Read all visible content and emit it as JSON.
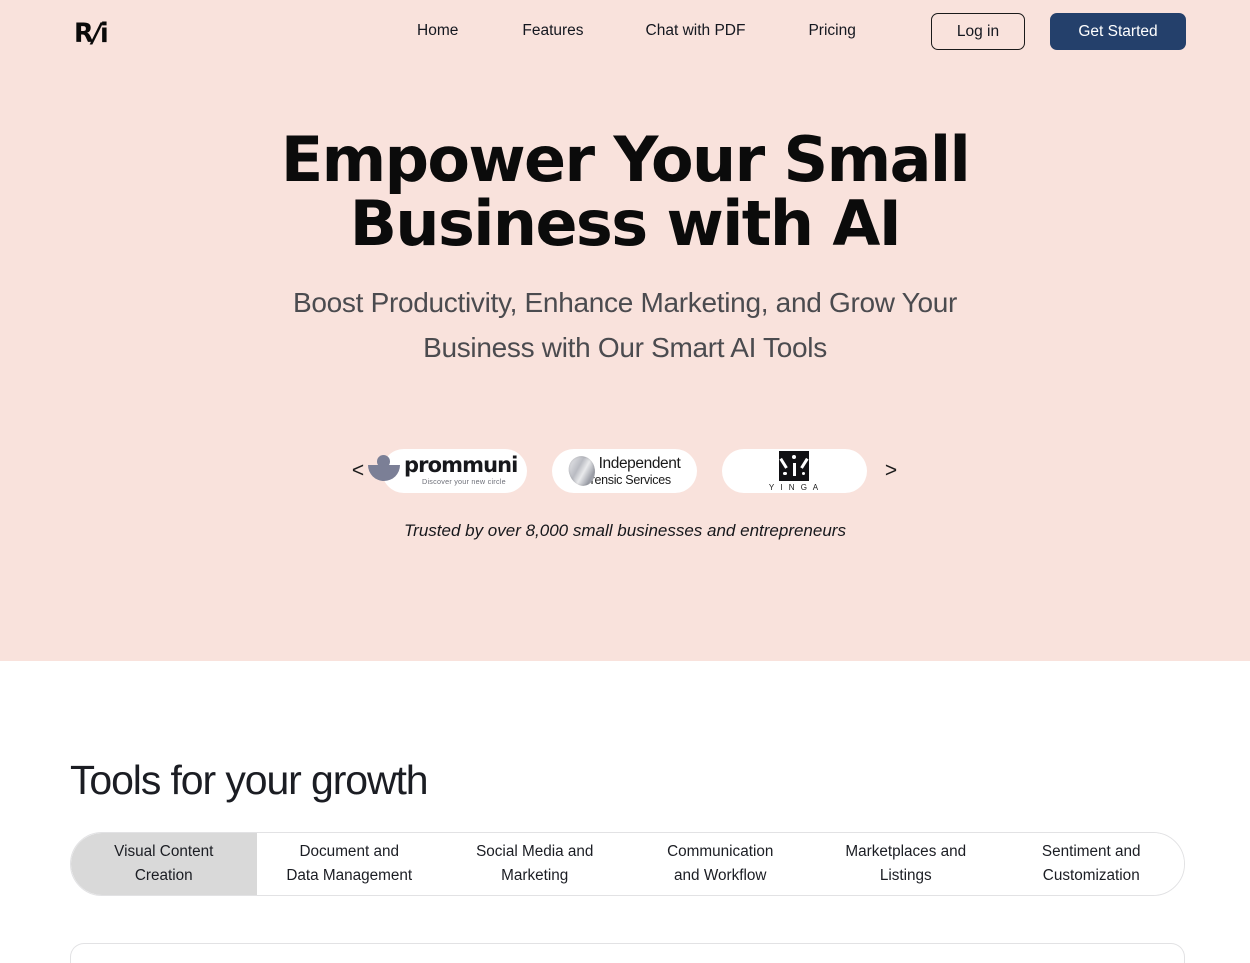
{
  "brand": {
    "logo_text": "R/i",
    "logo_part1": "R",
    "logo_slash": "/",
    "logo_part2": "i"
  },
  "colors": {
    "hero_bg": "#F9E2DC",
    "accent_navy": "#24406B",
    "active_tab_gray": "#D9D9D9",
    "text_dark": "#0B0B0B",
    "text_muted": "#4B4B4F"
  },
  "nav": {
    "links": [
      {
        "label": "Home"
      },
      {
        "label": "Features"
      },
      {
        "label": "Chat with PDF"
      },
      {
        "label": "Pricing"
      }
    ],
    "login_label": "Log in",
    "get_started_label": "Get Started"
  },
  "hero": {
    "headline_line1": "Empower Your Small",
    "headline_line2": "Business with AI",
    "subhead_line1": "Boost Productivity, Enhance Marketing, and Grow Your",
    "subhead_line2": "Business with Our Smart AI Tools",
    "trusted_text": "Trusted by over 8,000 small businesses and entrepreneurs"
  },
  "carousel": {
    "prev_label": "<",
    "next_label": ">",
    "logos": [
      {
        "name": "prommuni",
        "tagline": "Discover your new circle",
        "icon": "prommuni-logo-icon"
      },
      {
        "name_line1": "Independent",
        "name_line2": "Forensic Services",
        "icon": "independent-forensic-services-logo-icon"
      },
      {
        "name": "Y I N G A",
        "icon": "yinga-logo-icon"
      }
    ]
  },
  "tools": {
    "title": "Tools for your growth",
    "tabs": [
      {
        "line1": "Visual Content",
        "line2": "Creation",
        "active": true
      },
      {
        "line1": "Document and",
        "line2": "Data Management",
        "active": false
      },
      {
        "line1": "Social Media and",
        "line2": "Marketing",
        "active": false
      },
      {
        "line1": "Communication",
        "line2": "and Workflow",
        "active": false
      },
      {
        "line1": "Marketplaces and",
        "line2": "Listings",
        "active": false
      },
      {
        "line1": "Sentiment and",
        "line2": "Customization",
        "active": false
      }
    ]
  }
}
